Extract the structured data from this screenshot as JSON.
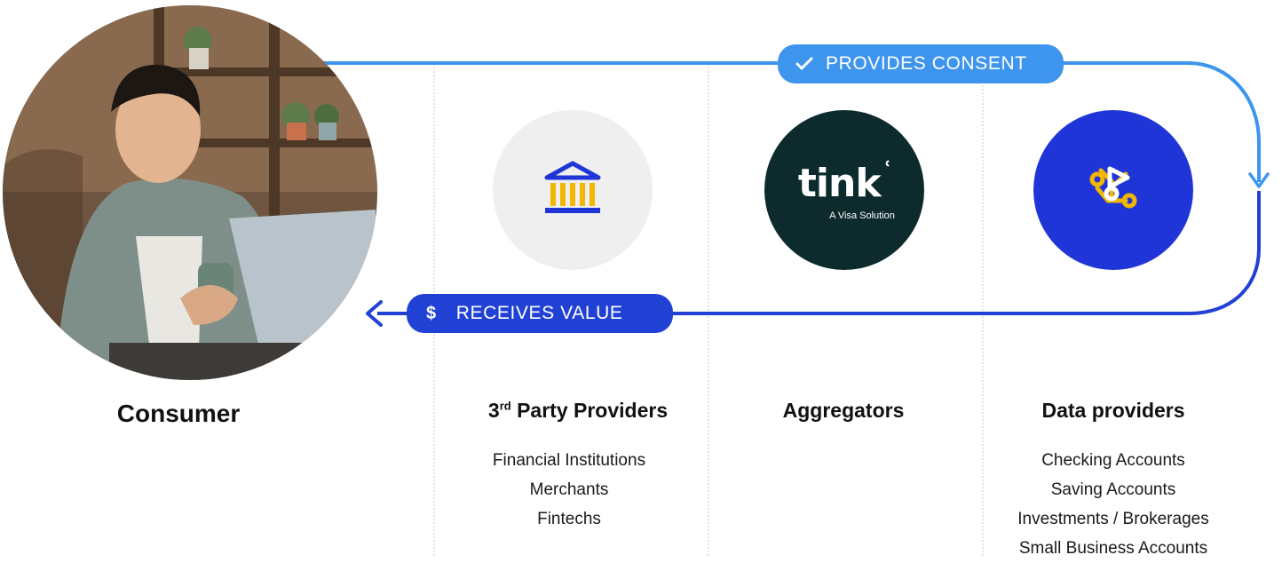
{
  "colors": {
    "consent": "#3d95ee",
    "value": "#2141d4",
    "aggregator_bg": "#0d2b2c",
    "data_bg": "#1f35d8",
    "tpp_bg": "#efefef",
    "bank_icon": "#f2b700"
  },
  "consumer": {
    "title": "Consumer",
    "image": "person-with-laptop"
  },
  "flows": {
    "consent": {
      "label": "PROVIDES CONSENT",
      "icon": "check-icon"
    },
    "value": {
      "label": "RECEIVES VALUE",
      "icon": "dollar-icon"
    }
  },
  "columns": [
    {
      "id": "tpp",
      "title_main": "3",
      "title_sup": "rd",
      "title_rest": " Party Providers",
      "icon": "bank-icon",
      "items": [
        "Financial Institutions",
        "Merchants",
        "Fintechs"
      ]
    },
    {
      "id": "aggregators",
      "title": "Aggregators",
      "logo_word": "tink",
      "logo_tagline": "A Visa Solution",
      "icon": "tink-logo"
    },
    {
      "id": "data",
      "title": "Data providers",
      "icon": "network-nodes-icon",
      "items": [
        "Checking Accounts",
        "Saving Accounts",
        "Investments / Brokerages",
        "Small Business Accounts"
      ]
    }
  ]
}
